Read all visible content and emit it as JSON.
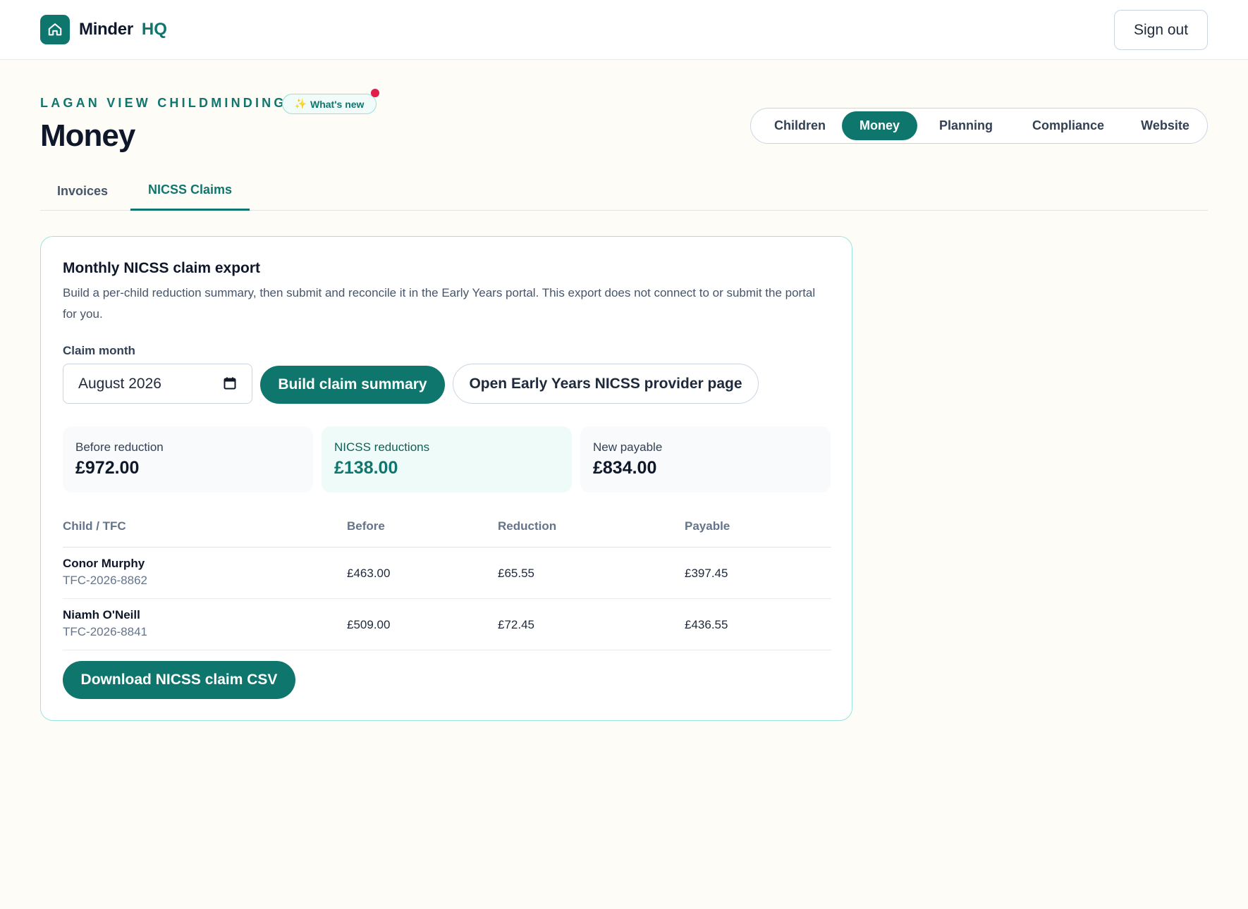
{
  "header": {
    "brand_name": "Minder",
    "brand_suffix": "HQ",
    "signout_label": "Sign out",
    "logo_icon": "house-icon"
  },
  "page": {
    "org_name": "LAGAN VIEW CHILDMINDING",
    "whats_new_label": "What's new",
    "title": "Money"
  },
  "nav": {
    "items": [
      {
        "label": "Children",
        "active": false
      },
      {
        "label": "Money",
        "active": true
      },
      {
        "label": "Planning",
        "active": false
      },
      {
        "label": "Compliance",
        "active": false
      },
      {
        "label": "Website",
        "active": false
      }
    ]
  },
  "subtabs": {
    "items": [
      {
        "label": "Invoices",
        "active": false
      },
      {
        "label": "NICSS Claims",
        "active": true
      }
    ]
  },
  "card": {
    "title": "Monthly NICSS claim export",
    "description": "Build a per-child reduction summary, then submit and reconcile it in the Early Years portal. This export does not connect to or submit the portal for you.",
    "month_label": "Claim month",
    "month_value": "August 2026",
    "build_label": "Build claim summary",
    "portal_label": "Open Early Years NICSS provider page",
    "download_label": "Download NICSS claim CSV"
  },
  "stats": {
    "before": {
      "label": "Before reduction",
      "value": "£972.00"
    },
    "reductions": {
      "label": "NICSS reductions",
      "value": "£138.00"
    },
    "payable": {
      "label": "New payable",
      "value": "£834.00"
    }
  },
  "table": {
    "headers": {
      "child": "Child / TFC",
      "before": "Before",
      "reduction": "Reduction",
      "payable": "Payable"
    },
    "rows": [
      {
        "name": "Conor Murphy",
        "tfc": "TFC-2026-8862",
        "before": "£463.00",
        "reduction": "£65.55",
        "payable": "£397.45"
      },
      {
        "name": "Niamh O'Neill",
        "tfc": "TFC-2026-8841",
        "before": "£509.00",
        "reduction": "£72.45",
        "payable": "£436.55"
      }
    ]
  },
  "colors": {
    "brand": "#0f766e",
    "background": "#fdfcf7",
    "notification_dot": "#e11d48"
  }
}
